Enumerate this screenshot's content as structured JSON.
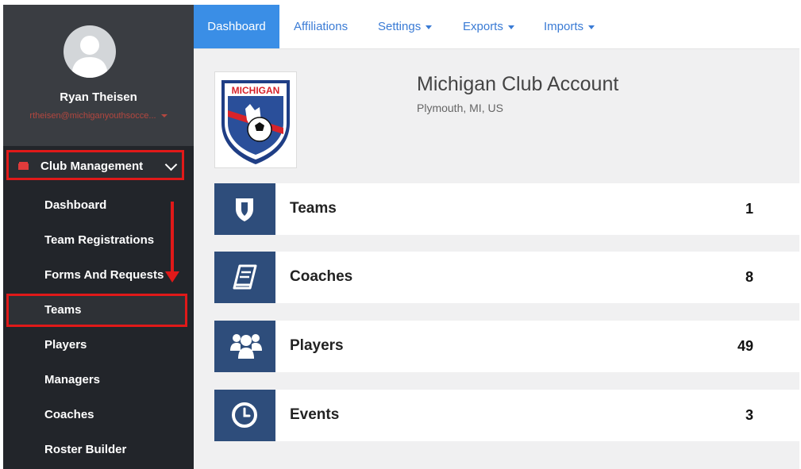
{
  "user": {
    "name": "Ryan Theisen",
    "email": "rtheisen@michiganyouthsocce..."
  },
  "sidebar": {
    "section_label": "Club Management",
    "items": [
      {
        "label": "Dashboard"
      },
      {
        "label": "Team Registrations"
      },
      {
        "label": "Forms And Requests"
      },
      {
        "label": "Teams"
      },
      {
        "label": "Players"
      },
      {
        "label": "Managers"
      },
      {
        "label": "Coaches"
      },
      {
        "label": "Roster Builder"
      }
    ]
  },
  "topnav": {
    "tabs": [
      {
        "label": "Dashboard"
      },
      {
        "label": "Affiliations"
      },
      {
        "label": "Settings"
      },
      {
        "label": "Exports"
      },
      {
        "label": "Imports"
      }
    ]
  },
  "club": {
    "title": "Michigan Club Account",
    "location": "Plymouth, MI, US",
    "logo_text": "MICHIGAN"
  },
  "stats": [
    {
      "label": "Teams",
      "count": "1",
      "icon": "shield-icon"
    },
    {
      "label": "Coaches",
      "count": "8",
      "icon": "book-icon"
    },
    {
      "label": "Players",
      "count": "49",
      "icon": "users-icon"
    },
    {
      "label": "Events",
      "count": "3",
      "icon": "clock-icon"
    }
  ],
  "colors": {
    "accent": "#3a8ee6",
    "icon_bg": "#2e4d7b",
    "highlight": "#e01919",
    "sidebar": "#22252a"
  }
}
